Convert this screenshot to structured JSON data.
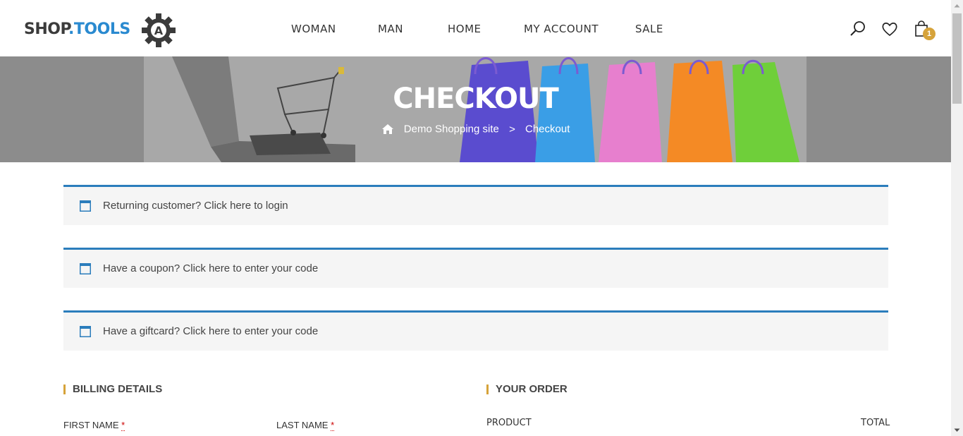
{
  "header": {
    "logo": {
      "part1": "SHOP",
      "dot": ".",
      "part2": "TOOLS",
      "mark": "A"
    },
    "nav": [
      "WOMAN",
      "MAN",
      "HOME",
      "MY ACCOUNT",
      "SALE"
    ],
    "icons": [
      "search-icon",
      "heart-icon",
      "shopping-bag-icon"
    ],
    "cart_count": "1"
  },
  "hero": {
    "title": "CHECKOUT",
    "breadcrumb": {
      "home": "Demo Shopping site",
      "separator": ">",
      "current": "Checkout"
    }
  },
  "notices": [
    {
      "text": "Returning customer? Click here to login"
    },
    {
      "text": "Have a coupon? Click here to enter your code"
    },
    {
      "text": "Have a giftcard? Click here to enter your code"
    }
  ],
  "billing": {
    "title": "BILLING DETAILS",
    "first_name_label": "FIRST NAME",
    "last_name_label": "LAST NAME",
    "required_mark": "*"
  },
  "order": {
    "title": "YOUR ORDER",
    "col_product": "PRODUCT",
    "col_total": "TOTAL"
  },
  "colors": {
    "accent_blue": "#2b7dbc",
    "accent_gold": "#d6a33a"
  }
}
